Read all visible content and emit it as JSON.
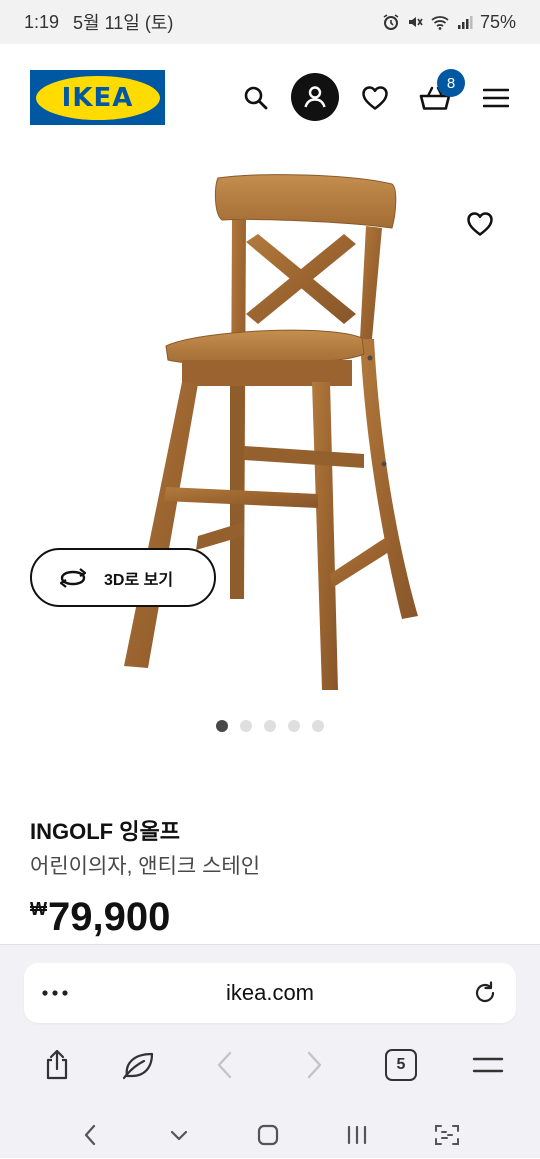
{
  "status_bar": {
    "time": "1:19",
    "date": "5월 11일 (토)",
    "battery": "75%"
  },
  "header": {
    "logo_text": "IKEA",
    "cart_count": "8",
    "brand_blue": "#0058a3",
    "brand_yellow": "#ffdb00"
  },
  "product": {
    "view_3d_label": "3D로 보기",
    "carousel": {
      "total": 5,
      "active": 1
    },
    "name": "INGOLF 잉올프",
    "description": "어린이의자, 앤티크 스테인",
    "currency": "₩",
    "price": "79,900"
  },
  "browser": {
    "url": "ikea.com",
    "tab_count": "5"
  },
  "icons": [
    "search-icon",
    "account-icon",
    "heart-icon",
    "cart-icon",
    "menu-icon",
    "rotate-3d-icon",
    "more-icon",
    "reload-icon",
    "share-icon",
    "leaf-icon",
    "back-icon",
    "forward-icon",
    "hamburger-icon"
  ]
}
